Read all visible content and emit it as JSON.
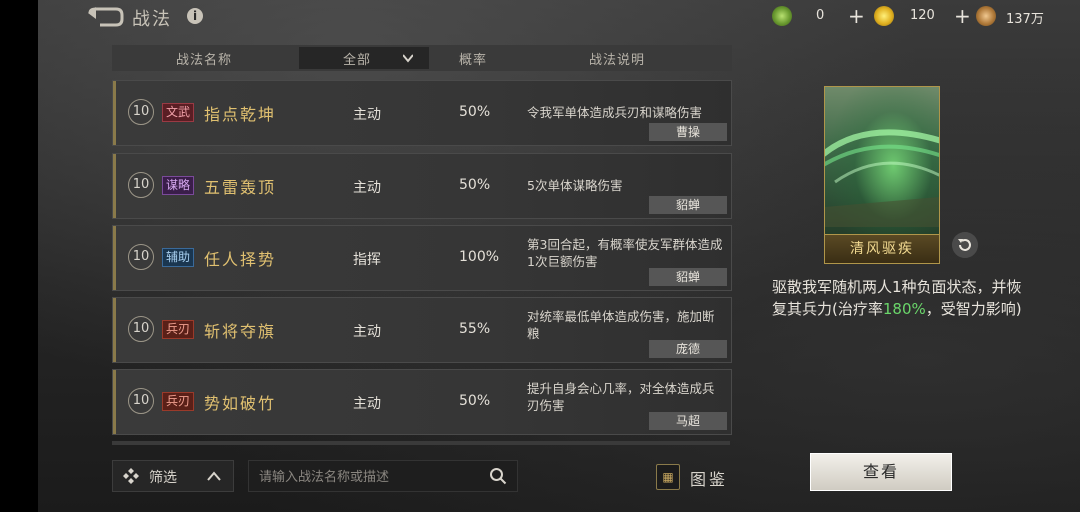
{
  "header": {
    "title": "战法"
  },
  "resources": [
    {
      "icon": "jade-coin-icon",
      "value": "0"
    },
    {
      "icon": "gold-coin-icon",
      "value": "120"
    },
    {
      "icon": "copper-coin-icon",
      "value": "137万"
    }
  ],
  "table": {
    "col_name": "战法名称",
    "filter_value": "全部",
    "col_prob": "概率",
    "col_desc": "战法说明"
  },
  "rows": [
    {
      "level": "10",
      "tag": "文武",
      "name": "指点乾坤",
      "type": "主动",
      "prob": "50%",
      "desc": "令我军单体造成兵刃和谋略伤害",
      "owner": "曹操"
    },
    {
      "level": "10",
      "tag": "谋略",
      "name": "五雷轰顶",
      "type": "主动",
      "prob": "50%",
      "desc": "5次单体谋略伤害",
      "owner": "貂蝉"
    },
    {
      "level": "10",
      "tag": "辅助",
      "name": "任人择势",
      "type": "指挥",
      "prob": "100%",
      "desc": "第3回合起，有概率使友军群体造成1次巨额伤害",
      "owner": "貂蝉"
    },
    {
      "level": "10",
      "tag": "兵刃",
      "name": "斩将夺旗",
      "type": "主动",
      "prob": "55%",
      "desc": "对统率最低单体造成伤害，施加断粮",
      "owner": "庞德"
    },
    {
      "level": "10",
      "tag": "兵刃",
      "name": "势如破竹",
      "type": "主动",
      "prob": "50%",
      "desc": "提升自身会心几率，对全体造成兵刃伤害",
      "owner": "马超"
    }
  ],
  "bottom": {
    "filter_label": "筛选",
    "search_placeholder": "请输入战法名称或描述",
    "atlas_label": "图鉴"
  },
  "detail": {
    "card_name": "清风驱疾",
    "desc_a": "驱散我军随机两人1种负面状态，并恢复其兵力(治疗率",
    "desc_highlight": "180%",
    "desc_b": "，受智力影响)",
    "view_label": "查看"
  },
  "colors": {
    "gold": "#e0c070",
    "highlight_green": "#6ad66a",
    "card_border": "#b0964a"
  }
}
